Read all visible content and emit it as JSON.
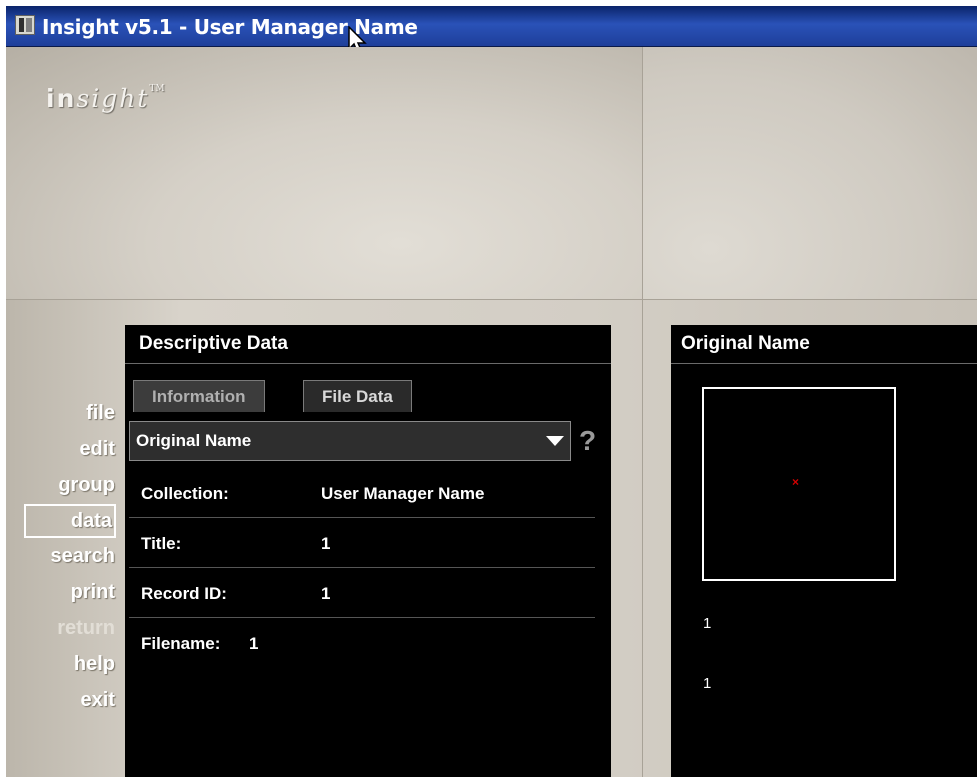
{
  "window": {
    "title": "Insight v5.1 - User Manager Name"
  },
  "logo": {
    "in": "in",
    "sight": "sight",
    "tm": "TM"
  },
  "nav": {
    "items": [
      {
        "label": "file",
        "state": "normal"
      },
      {
        "label": "edit",
        "state": "normal"
      },
      {
        "label": "group",
        "state": "normal"
      },
      {
        "label": "data",
        "state": "selected"
      },
      {
        "label": "search",
        "state": "normal"
      },
      {
        "label": "print",
        "state": "normal"
      },
      {
        "label": "return",
        "state": "disabled"
      },
      {
        "label": "help",
        "state": "normal"
      },
      {
        "label": "exit",
        "state": "normal"
      }
    ]
  },
  "descriptive": {
    "header": "Descriptive Data",
    "tabs": [
      {
        "label": "Information",
        "active": false
      },
      {
        "label": "File Data",
        "active": true
      }
    ],
    "dropdown": {
      "value": "Original Name"
    },
    "help_icon": "?",
    "fields": [
      {
        "label": "Collection:",
        "value": "User Manager Name"
      },
      {
        "label": "Title:",
        "value": "1"
      },
      {
        "label": "Record ID:",
        "value": "1"
      },
      {
        "label": "Filename:",
        "value": "1"
      }
    ]
  },
  "original": {
    "header": "Original Name",
    "thumb_mark": "×",
    "lines": [
      "1",
      "1"
    ]
  },
  "colors": {
    "titlebar": "#0a246a",
    "panel_bg": "#000000",
    "thumb_mark": "#d40000"
  },
  "icons": {
    "app": "insight-app-icon",
    "cursor": "mouse-pointer-icon",
    "dropdown": "triangle-down-icon",
    "help": "question-mark-icon",
    "broken_image": "broken-image-icon"
  }
}
